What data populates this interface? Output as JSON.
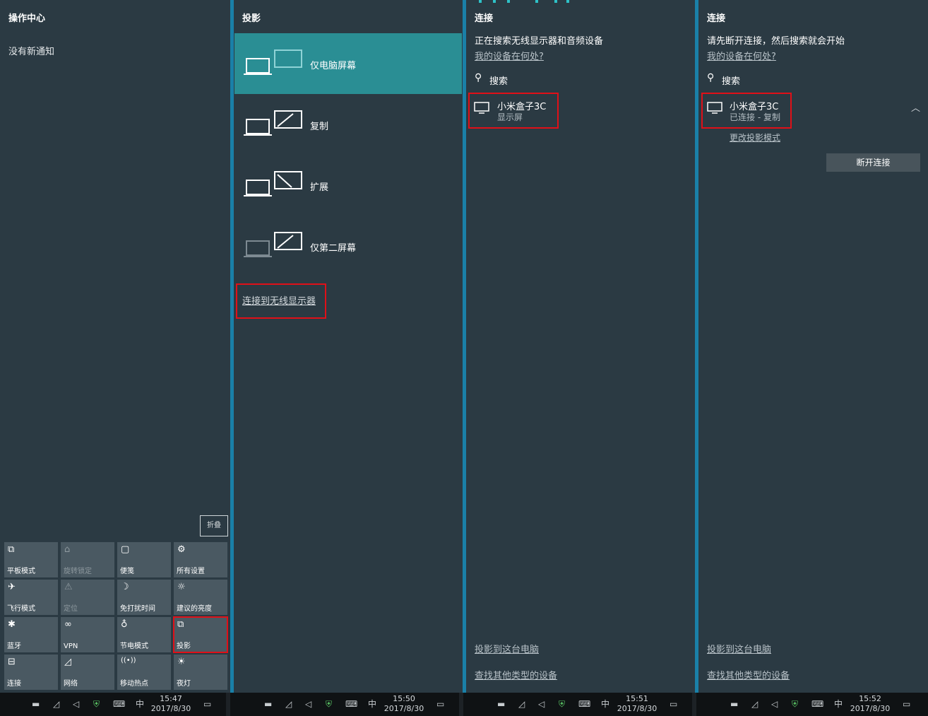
{
  "action_center": {
    "title": "操作中心",
    "no_notifications": "没有新通知",
    "collapse_label": "折叠",
    "tiles": [
      {
        "label": "平板模式",
        "icon": "tablet-mode-icon",
        "glyph": "⧉"
      },
      {
        "label": "旋转锁定",
        "icon": "rotation-lock-icon",
        "glyph": "⌂"
      },
      {
        "label": "便笺",
        "icon": "note-icon",
        "glyph": "▢"
      },
      {
        "label": "所有设置",
        "icon": "gear-icon",
        "glyph": "⚙"
      },
      {
        "label": "飞行模式",
        "icon": "airplane-icon",
        "glyph": "✈"
      },
      {
        "label": "定位",
        "icon": "location-icon",
        "glyph": "⚠"
      },
      {
        "label": "免打扰时间",
        "icon": "moon-icon",
        "glyph": "☽"
      },
      {
        "label": "建议的亮度",
        "icon": "brightness-icon",
        "glyph": "☼"
      },
      {
        "label": "蓝牙",
        "icon": "bluetooth-icon",
        "glyph": "✱"
      },
      {
        "label": "VPN",
        "icon": "vpn-icon",
        "glyph": "∞"
      },
      {
        "label": "节电模式",
        "icon": "battery-saver-icon",
        "glyph": "♁"
      },
      {
        "label": "投影",
        "icon": "project-icon",
        "glyph": "⧉"
      },
      {
        "label": "连接",
        "icon": "connect-icon",
        "glyph": "⊟"
      },
      {
        "label": "网络",
        "icon": "network-icon",
        "glyph": "◿"
      },
      {
        "label": "移动热点",
        "icon": "hotspot-icon",
        "glyph": "((•))"
      },
      {
        "label": "夜灯",
        "icon": "night-light-icon",
        "glyph": "☀"
      }
    ]
  },
  "project": {
    "title": "投影",
    "options": [
      "仅电脑屏幕",
      "复制",
      "扩展",
      "仅第二屏幕"
    ],
    "wireless_link": "连接到无线显示器"
  },
  "connect_searching": {
    "title": "连接",
    "status": "正在搜索无线显示器和音频设备",
    "where_link": "我的设备在何处?",
    "search_label": "搜索",
    "device_name": "小米盒子3C",
    "device_sub": "显示屏",
    "project_to_pc": "投影到这台电脑",
    "find_other": "查找其他类型的设备"
  },
  "connect_connected": {
    "title": "连接",
    "status": "请先断开连接，然后搜索就会开始",
    "where_link": "我的设备在何处?",
    "search_label": "搜索",
    "device_name": "小米盒子3C",
    "device_sub": "已连接 - 复制",
    "change_mode": "更改投影模式",
    "disconnect": "断开连接",
    "project_to_pc": "投影到这台电脑",
    "find_other": "查找其他类型的设备"
  },
  "taskbars": [
    {
      "time": "15:47",
      "date": "2017/8/30"
    },
    {
      "time": "15:50",
      "date": "2017/8/30"
    },
    {
      "time": "15:51",
      "date": "2017/8/30"
    },
    {
      "time": "15:52",
      "date": "2017/8/30"
    }
  ],
  "taskbar_ime": "中",
  "colors": {
    "panel_bg": "#2b3a43",
    "accent": "#2a8e94",
    "highlight": "#e01018",
    "taskbar_bg": "#0f1214"
  }
}
